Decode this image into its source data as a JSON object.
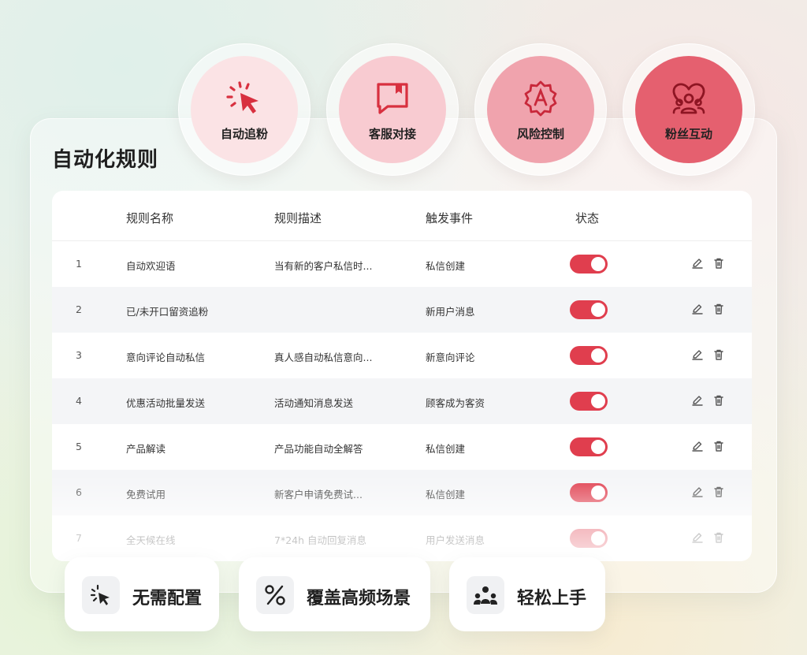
{
  "features": [
    {
      "label": "自动追粉",
      "icon": "cursor-click-icon"
    },
    {
      "label": "客服对接",
      "icon": "chat-bubble-icon"
    },
    {
      "label": "风险控制",
      "icon": "shield-a-icon"
    },
    {
      "label": "粉丝互动",
      "icon": "users-heart-icon"
    }
  ],
  "panel": {
    "title": "自动化规则"
  },
  "table": {
    "headers": {
      "name": "规则名称",
      "desc": "规则描述",
      "event": "触发事件",
      "status": "状态"
    },
    "rows": [
      {
        "no": "1",
        "name": "自动欢迎语",
        "desc": "当有新的客户私信时...",
        "event": "私信创建",
        "enabled": true
      },
      {
        "no": "2",
        "name": "已/未开口留资追粉",
        "desc": "",
        "event": "新用户消息",
        "enabled": true
      },
      {
        "no": "3",
        "name": "意向评论自动私信",
        "desc": "真人感自动私信意向...",
        "event": "新意向评论",
        "enabled": true
      },
      {
        "no": "4",
        "name": "优惠活动批量发送",
        "desc": "活动通知消息发送",
        "event": "顾客成为客资",
        "enabled": true
      },
      {
        "no": "5",
        "name": "产品解读",
        "desc": "产品功能自动全解答",
        "event": "私信创建",
        "enabled": true
      },
      {
        "no": "6",
        "name": "免费试用",
        "desc": "新客户申请免费试...",
        "event": "私信创建",
        "enabled": true
      },
      {
        "no": "7",
        "name": "全天候在线",
        "desc": "7*24h 自动回复消息",
        "event": "用户发送消息",
        "enabled": true
      }
    ]
  },
  "highlights": [
    {
      "label": "无需配置",
      "icon": "sparkle-cursor-icon"
    },
    {
      "label": "覆盖高频场景",
      "icon": "percent-icon"
    },
    {
      "label": "轻松上手",
      "icon": "team-icon"
    }
  ],
  "colors": {
    "accent": "#e03e4e",
    "toggle_on": "#e03e4e"
  }
}
